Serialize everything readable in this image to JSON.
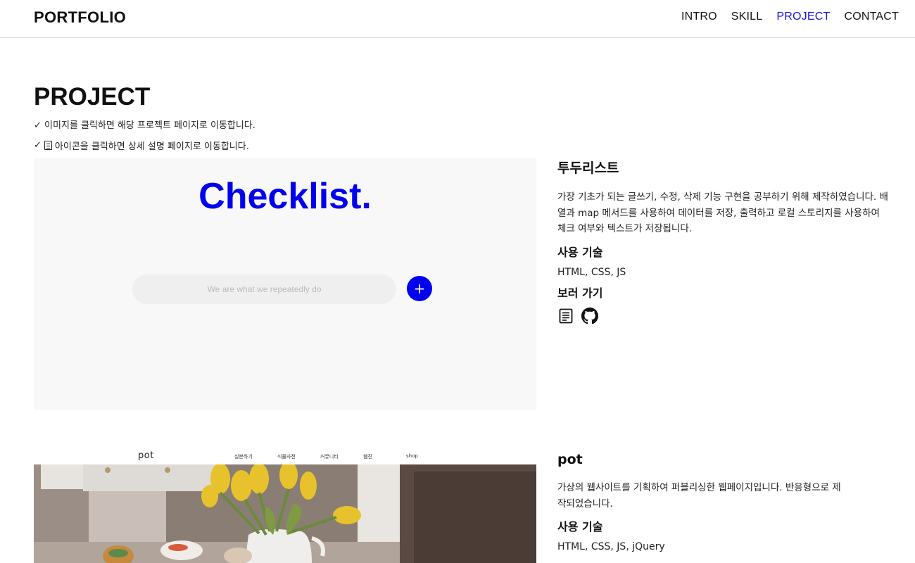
{
  "header": {
    "logo": "PORTFOLIO",
    "nav": [
      {
        "label": "INTRO"
      },
      {
        "label": "SKILL"
      },
      {
        "label": "PROJECT"
      },
      {
        "label": "CONTACT"
      }
    ],
    "active_color": "#1a12e0"
  },
  "section": {
    "title": "PROJECT",
    "note1": "✓ 이미지를 클릭하면 해당 프로젝트 페이지로 이동합니다.",
    "note2_check": "✓",
    "note2": "아이콘을 클릭하면 상세 설명 페이지로 이동합니다."
  },
  "projects": [
    {
      "name": "투두리스트",
      "description": "가장 기초가 되는 글쓰기, 수정, 삭제 기능 구현을 공부하기 위해 제작하였습니다. 배열과 map 메서드를 사용하여 데이터를 저장, 출력하고 로컬 스토리지를 사용하여 체크 여부와 텍스트가 저장됩니다.",
      "tech_heading": "사용 기술",
      "tech": "HTML, CSS, JS",
      "links_heading": "보러 가기",
      "preview": {
        "title": "Checklist.",
        "input_placeholder": "We are what we repeatedly do",
        "add_symbol": "+",
        "accent": "#0000ee"
      }
    },
    {
      "name": "pot",
      "description": "가상의 웹사이트를 기획하여 퍼블리싱한 웹페이지입니다. 반응형으로 제작되었습니다.",
      "tech_heading": "사용 기술",
      "tech": "HTML, CSS, JS, jQuery",
      "preview": {
        "logo": "pot",
        "menu": [
          "실분하기",
          "식물사전",
          "커뮤니티",
          "웹진",
          "shop"
        ]
      }
    }
  ],
  "icons": [
    "document-icon",
    "github-icon",
    "plus-icon"
  ]
}
